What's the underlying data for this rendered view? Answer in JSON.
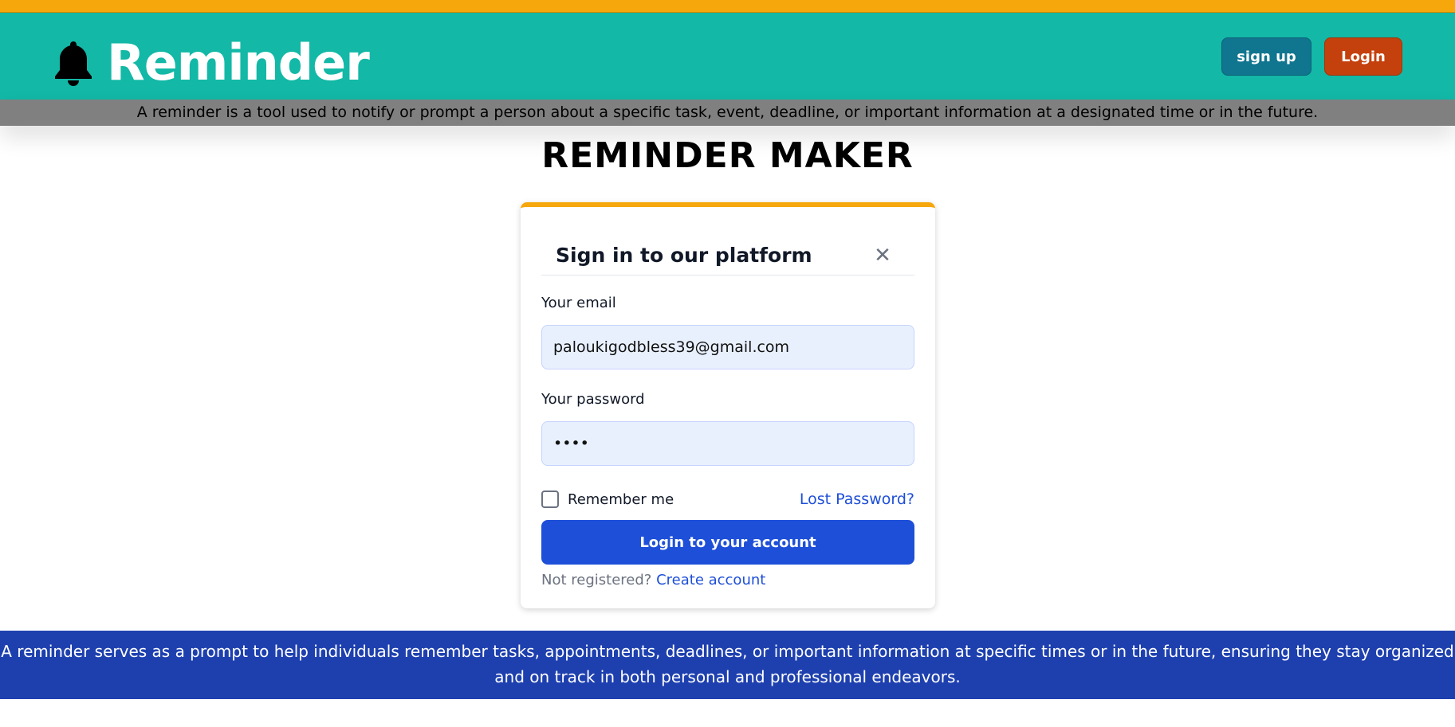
{
  "header": {
    "brand": "Reminder",
    "signup_label": "sign up",
    "login_label": "Login",
    "brand_icon": "bell-icon",
    "colors": {
      "header_bg": "#13b8a6",
      "top_stripe": "#f5a70c",
      "signup_bg": "#10758f",
      "login_bg": "#c4400d"
    }
  },
  "tagline": "A reminder is a tool used to notify or prompt a person about a specific task, event, deadline, or important information at a designated time or in the future.",
  "page_title": "REMINDER MAKER",
  "login_card": {
    "title": "Sign in to our platform",
    "close_icon": "close-icon",
    "email_label": "Your email",
    "email_value": "paloukigodbless39@gmail.com",
    "password_label": "Your password",
    "password_value": "••••",
    "remember_label": "Remember me",
    "lost_password": "Lost Password?",
    "submit_label": "Login to your account",
    "not_registered": "Not registered?",
    "create_account": "Create account",
    "colors": {
      "primary": "#1d4fd8",
      "accent_top": "#f5a70c",
      "field_bg": "#e8f0fe"
    }
  },
  "footer": {
    "text": "A reminder serves as a prompt to help individuals remember tasks, appointments, deadlines, or important information at specific times or in the future, ensuring they stay organized and on track in both personal and professional endeavors.",
    "colors": {
      "bg": "#1e40af"
    }
  }
}
